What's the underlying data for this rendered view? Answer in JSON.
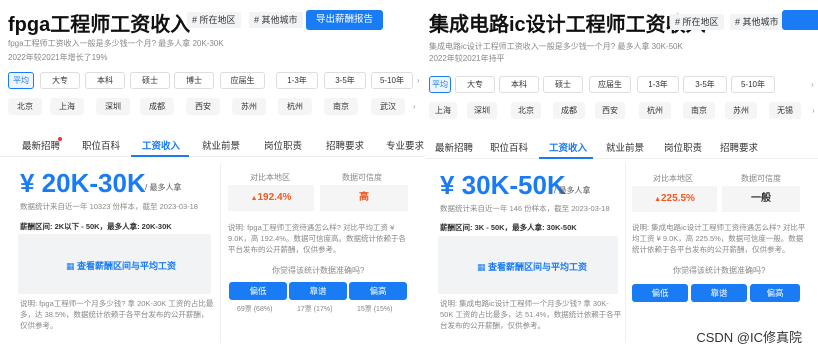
{
  "left": {
    "title": "fpga工程师工资收入",
    "tags": [
      "# 所在地区",
      "# 其他城市"
    ],
    "export_label": "导出薪酬报告",
    "desc": "fpga工程师工资收入一般是多少钱一个月? 最多人拿 20K-30K",
    "growth": "2022年较2021年增长了19%",
    "edu_chips": [
      "平均",
      "大专",
      "本科",
      "硕士",
      "博士",
      "应届生",
      "1-3年",
      "3-5年",
      "5-10年"
    ],
    "city_chips": [
      "北京",
      "上海",
      "深圳",
      "成都",
      "西安",
      "苏州",
      "杭州",
      "南京",
      "武汉"
    ],
    "tabs": [
      "最新招聘",
      "职位百科",
      "工资收入",
      "就业前景",
      "岗位职责",
      "招聘要求",
      "专业要求"
    ],
    "salary": "¥ 20K-30K",
    "salary_suffix": "/ 最多人拿",
    "stat_note": "数据统计来自近一年 10323 份样本，截至 2023-03-18",
    "range_note": "薪酬区间: 2K以下 - 50K，最多人拿: 20K-30K",
    "view_link": "查看薪酬区间与平均工资",
    "bottom_note": "说明: fpga工程师一个月多少钱? 拿 20K-30K 工资的占比最多，达 38.5%，数据统计依赖于各平台发布的公开薪酬，仅供参考。",
    "compare_label": "对比本地区",
    "credibility_label": "数据可信度",
    "compare_value": "192.4%",
    "credibility_value": "高",
    "compare_note": "说明: fpga工程师工资待遇怎么样? 对比平均工资 ¥ 9.0K，高 192.4%。数据可信度高。数据统计依赖于各平台发布的公开薪酬，仅供参考。",
    "vote_question": "你觉得该统计数据准确吗?",
    "votes": [
      "偏低",
      "靠谱",
      "偏高"
    ],
    "vote_counts": [
      "69票 (68%)",
      "17票 (17%)",
      "15票 (15%)"
    ]
  },
  "right": {
    "title": "集成电路ic设计工程师工资收入",
    "tags": [
      "# 所在地区",
      "# 其他城市"
    ],
    "desc": "集成电路ic设计工程师工资收入一般是多少钱一个月? 最多人拿 30K-50K",
    "growth": "2022年较2021年持平",
    "edu_chips": [
      "平均",
      "大专",
      "本科",
      "硕士",
      "应届生",
      "1-3年",
      "3-5年",
      "5-10年"
    ],
    "city_chips": [
      "上海",
      "深圳",
      "北京",
      "成都",
      "西安",
      "杭州",
      "南京",
      "苏州",
      "无锡"
    ],
    "tabs": [
      "最新招聘",
      "职位百科",
      "工资收入",
      "就业前景",
      "岗位职责",
      "招聘要求"
    ],
    "salary": "¥ 30K-50K",
    "salary_suffix": "/ 最多人拿",
    "stat_note": "数据统计来自近一年 146 份样本，截至 2023-03-18",
    "range_note": "薪酬区间: 3K - 50K，最多人拿: 30K-50K",
    "view_link": "查看薪酬区间与平均工资",
    "bottom_note": "说明: 集成电路ic设计工程师一个月多少钱? 拿 30K-50K 工资的占比最多，达 51.4%，数据统计依赖于各平台发布的公开薪酬，仅供参考。",
    "compare_label": "对比本地区",
    "credibility_label": "数据可信度",
    "compare_value": "225.5%",
    "credibility_value": "一般",
    "compare_note": "说明: 集成电路ic设计工程师工资待遇怎么样? 对比平均工资 ¥ 9.0K，高 225.5%，数据可信度一般。数据统计依赖于各平台发布的公开薪酬，仅供参考。",
    "vote_question": "你觉得该统计数据准确吗?",
    "votes": [
      "偏低",
      "靠谱",
      "偏高"
    ]
  },
  "watermark": "CSDN @IC修真院",
  "colors": {
    "accent": "#1a7cf5",
    "up": "#f05a23"
  }
}
